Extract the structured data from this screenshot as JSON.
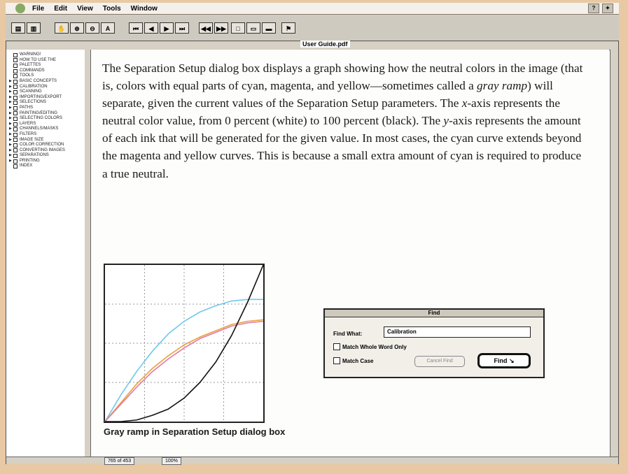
{
  "menubar": {
    "items": [
      "File",
      "Edit",
      "View",
      "Tools",
      "Window"
    ]
  },
  "window_title": "User Guide.pdf",
  "sidebar": {
    "items": [
      {
        "label": "WARNING!",
        "expandable": false
      },
      {
        "label": "HOW TO USE THE",
        "expandable": false
      },
      {
        "label": "PALETTES",
        "expandable": false
      },
      {
        "label": "COMMANDS",
        "expandable": false
      },
      {
        "label": "TOOLS",
        "expandable": false
      },
      {
        "label": "BASIC CONCEPTS",
        "expandable": true
      },
      {
        "label": "CALIBRATION",
        "expandable": true
      },
      {
        "label": "SCANNING",
        "expandable": true
      },
      {
        "label": "IMPORTING/EXPORT",
        "expandable": true
      },
      {
        "label": "SELECTIONS",
        "expandable": true
      },
      {
        "label": "PATHS",
        "expandable": true
      },
      {
        "label": "PAINTING/EDITING",
        "expandable": true
      },
      {
        "label": "SELECTING COLORS",
        "expandable": true
      },
      {
        "label": "LAYERS",
        "expandable": true
      },
      {
        "label": "CHANNELS/MASKS",
        "expandable": true
      },
      {
        "label": "FILTERS",
        "expandable": true
      },
      {
        "label": "IMAGE SIZE",
        "expandable": true
      },
      {
        "label": "COLOR CORRECTION",
        "expandable": true
      },
      {
        "label": "CONVERTING IMAGES",
        "expandable": true
      },
      {
        "label": "SEPARATIONS",
        "expandable": true
      },
      {
        "label": "PRINTING",
        "expandable": true
      },
      {
        "label": "INDEX",
        "expandable": false
      }
    ]
  },
  "body": {
    "p1": "The Separation Setup dialog box displays a graph showing how the neutral colors in the image (that is, colors with equal parts of cyan, magenta, and yellow—sometimes called a ",
    "p1_italic": "gray ramp",
    "p2": ") will separate, given the current values of the Separation Setup parameters. The ",
    "x_italic": "x",
    "p3": "-axis represents the neutral color value, from 0 percent (white) to 100 percent (black). The ",
    "y_italic": "y",
    "p4": "-axis represents the amount of each ink that will be generated for the given value. In most cases, the cyan curve extends beyond the magenta and yellow curves. This is because a small extra amount of cyan is required to produce a true neutral."
  },
  "caption": "Gray ramp in Separation Setup dialog box",
  "chart_data": {
    "type": "line",
    "title": "",
    "xlabel": "",
    "ylabel": "",
    "xlim": [
      0,
      100
    ],
    "ylim": [
      0,
      100
    ],
    "grid": true,
    "x": [
      0,
      10,
      20,
      30,
      40,
      50,
      60,
      70,
      80,
      90,
      100
    ],
    "series": [
      {
        "color": "#6ec8ec",
        "values": [
          0,
          17,
          32,
          45,
          56,
          64,
          70,
          74,
          77,
          78,
          78
        ]
      },
      {
        "color": "#e8a03a",
        "values": [
          0,
          12,
          24,
          34,
          42,
          49,
          54,
          58,
          62,
          64,
          65
        ]
      },
      {
        "color": "#e07aa0",
        "values": [
          0,
          11,
          22,
          32,
          40,
          47,
          53,
          57,
          61,
          63,
          64
        ]
      },
      {
        "color": "#111111",
        "values": [
          0,
          0,
          1,
          4,
          8,
          15,
          25,
          38,
          55,
          76,
          100
        ]
      }
    ]
  },
  "find_dialog": {
    "title": "Find",
    "find_what_label": "Find What:",
    "find_what_value": "Calibration",
    "match_whole_word": "Match Whole Word Only",
    "match_case": "Match Case",
    "cancel_label": "Cancel Find",
    "find_label": "Find"
  },
  "status": {
    "page": "765 of 453",
    "zoom": "100%"
  }
}
